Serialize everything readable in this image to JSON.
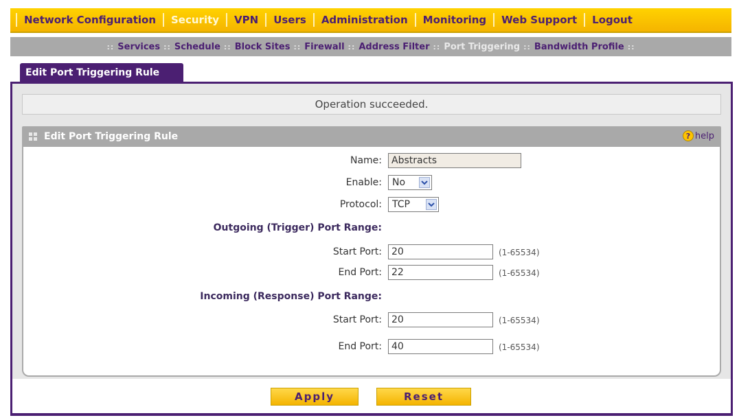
{
  "top_nav": {
    "items": [
      {
        "label": "Network Configuration",
        "active": false
      },
      {
        "label": "Security",
        "active": true
      },
      {
        "label": "VPN",
        "active": false
      },
      {
        "label": "Users",
        "active": false
      },
      {
        "label": "Administration",
        "active": false
      },
      {
        "label": "Monitoring",
        "active": false
      },
      {
        "label": "Web Support",
        "active": false
      },
      {
        "label": "Logout",
        "active": false
      }
    ]
  },
  "sub_nav": {
    "items": [
      {
        "label": "Services",
        "active": false
      },
      {
        "label": "Schedule",
        "active": false
      },
      {
        "label": "Block Sites",
        "active": false
      },
      {
        "label": "Firewall",
        "active": false
      },
      {
        "label": "Address Filter",
        "active": false
      },
      {
        "label": "Port Triggering",
        "active": true
      },
      {
        "label": "Bandwidth Profile",
        "active": false
      }
    ]
  },
  "tab": {
    "label": "Edit Port Triggering Rule"
  },
  "status": {
    "message": "Operation succeeded."
  },
  "section": {
    "title": "Edit Port Triggering Rule",
    "help_label": "help",
    "help_glyph": "?"
  },
  "form": {
    "name": {
      "label": "Name:",
      "value": "Abstracts"
    },
    "enable": {
      "label": "Enable:",
      "value": "No"
    },
    "protocol": {
      "label": "Protocol:",
      "value": "TCP"
    },
    "outgoing_heading": "Outgoing (Trigger) Port Range:",
    "outgoing_start": {
      "label": "Start Port:",
      "value": "20",
      "range": "(1-65534)"
    },
    "outgoing_end": {
      "label": "End Port:",
      "value": "22",
      "range": "(1-65534)"
    },
    "incoming_heading": "Incoming (Response) Port Range:",
    "incoming_start": {
      "label": "Start Port:",
      "value": "20",
      "range": "(1-65534)"
    },
    "incoming_end": {
      "label": "End Port:",
      "value": "40",
      "range": "(1-65534)"
    }
  },
  "buttons": {
    "apply": "Apply",
    "reset": "Reset"
  },
  "colors": {
    "brand_purple": "#4b1f72",
    "nav_yellow": "#ffd200",
    "bar_gray": "#a9a9a9"
  }
}
